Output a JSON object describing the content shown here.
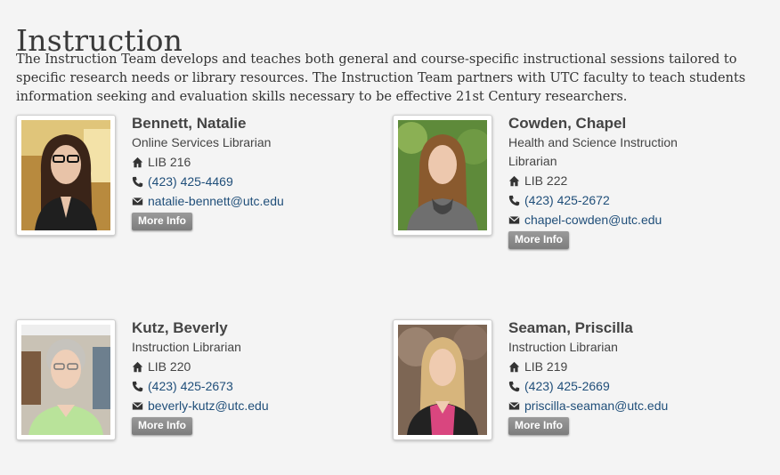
{
  "page": {
    "title": "Instruction",
    "intro": "The Instruction Team develops and teaches both general and course-specific instructional sessions tailored to specific research needs or library resources. The Instruction Team partners with UTC faculty to teach students information seeking and evaluation skills necessary to be effective 21st Century researchers."
  },
  "staff": [
    {
      "name": "Bennett, Natalie",
      "title": "Online Services Librarian",
      "room": "LIB 216",
      "phone": "(423) 425-4469",
      "email": "natalie-bennett@utc.edu",
      "more": "More Info"
    },
    {
      "name": "Cowden, Chapel",
      "title": "Health and Science Instruction Librarian",
      "room": "LIB 222",
      "phone": "(423) 425-2672",
      "email": "chapel-cowden@utc.edu",
      "more": "More Info"
    },
    {
      "name": "Kutz, Beverly",
      "title": "Instruction Librarian",
      "room": "LIB 220",
      "phone": "(423) 425-2673",
      "email": "beverly-kutz@utc.edu",
      "more": "More Info"
    },
    {
      "name": "Seaman, Priscilla",
      "title": "Instruction Librarian",
      "room": "LIB 219",
      "phone": "(423) 425-2669",
      "email": "priscilla-seaman@utc.edu",
      "more": "More Info"
    }
  ],
  "icons": {
    "room": "home-icon",
    "phone": "phone-icon",
    "email": "envelope-icon"
  },
  "colors": {
    "link": "#1f4e79",
    "button": "#8a8a8a",
    "background": "#f4f4f4"
  }
}
